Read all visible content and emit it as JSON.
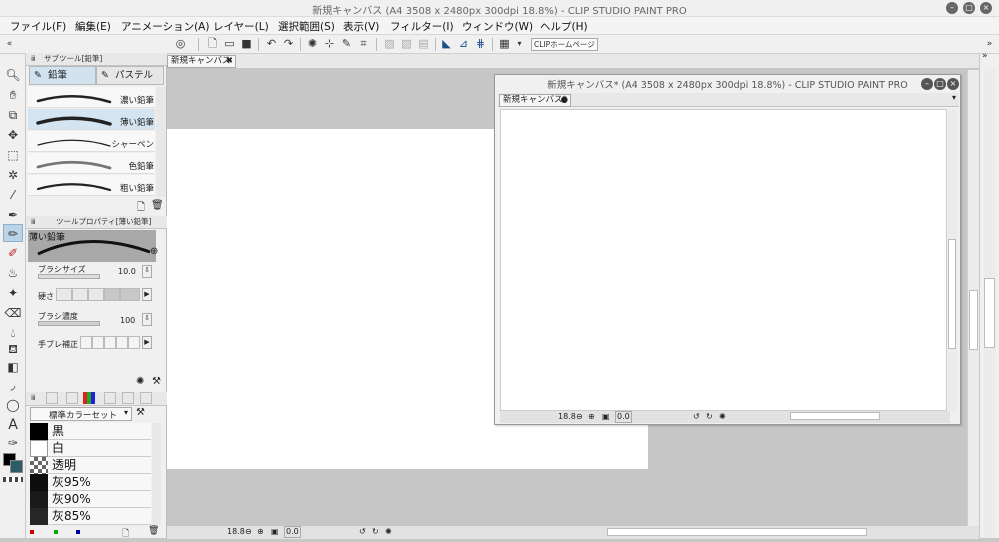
{
  "window": {
    "title": "新規キャンバス (A4 3508 x 2480px 300dpi 18.8%) - CLIP STUDIO PAINT PRO"
  },
  "menu": [
    "ファイル(F)",
    "編集(E)",
    "アニメーション(A)",
    "レイヤー(L)",
    "選択範囲(S)",
    "表示(V)",
    "フィルター(I)",
    "ウィンドウ(W)",
    "ヘルプ(H)"
  ],
  "command_bar": {
    "clip_home_label": "CLIPホームページ"
  },
  "subtool": {
    "header": "サブツール[鉛筆]",
    "tabs": [
      "鉛筆",
      "パステル"
    ],
    "brushes": [
      "濃い鉛筆",
      "薄い鉛筆",
      "シャーペン",
      "色鉛筆",
      "粗い鉛筆"
    ],
    "active_brush_index": 1
  },
  "tool_property": {
    "header": "ツールプロパティ[薄い鉛筆]",
    "preview_label": "薄い鉛筆",
    "brush_size_label": "ブラシサイズ",
    "brush_size_value": "10.0",
    "hardness_label": "硬さ",
    "density_label": "ブラシ濃度",
    "density_value": "100",
    "stabilization_label": "手ブレ補正"
  },
  "color_set": {
    "selector": "標準カラーセット",
    "colors": [
      {
        "name": "黒",
        "color": "#000000"
      },
      {
        "name": "白",
        "color": "#ffffff"
      },
      {
        "name": "透明",
        "color": "transparent"
      },
      {
        "name": "灰95%",
        "color": "#0d0d0d"
      },
      {
        "name": "灰90%",
        "color": "#1a1a1a"
      },
      {
        "name": "灰85%",
        "color": "#262626"
      }
    ]
  },
  "main_tab": {
    "label": "新規キャンバス"
  },
  "float_window": {
    "title": "新規キャンバス* (A4 3508 x 2480px 300dpi 18.8%) - CLIP STUDIO PAINT PRO",
    "tab_label": "新規キャンバス*",
    "zoom": "18.8",
    "rotation": "0.0"
  },
  "main_status": {
    "zoom": "18.8",
    "rotation": "0.0"
  },
  "colors": {
    "main_color": "#000000",
    "sub_color": "#2e5b66"
  }
}
